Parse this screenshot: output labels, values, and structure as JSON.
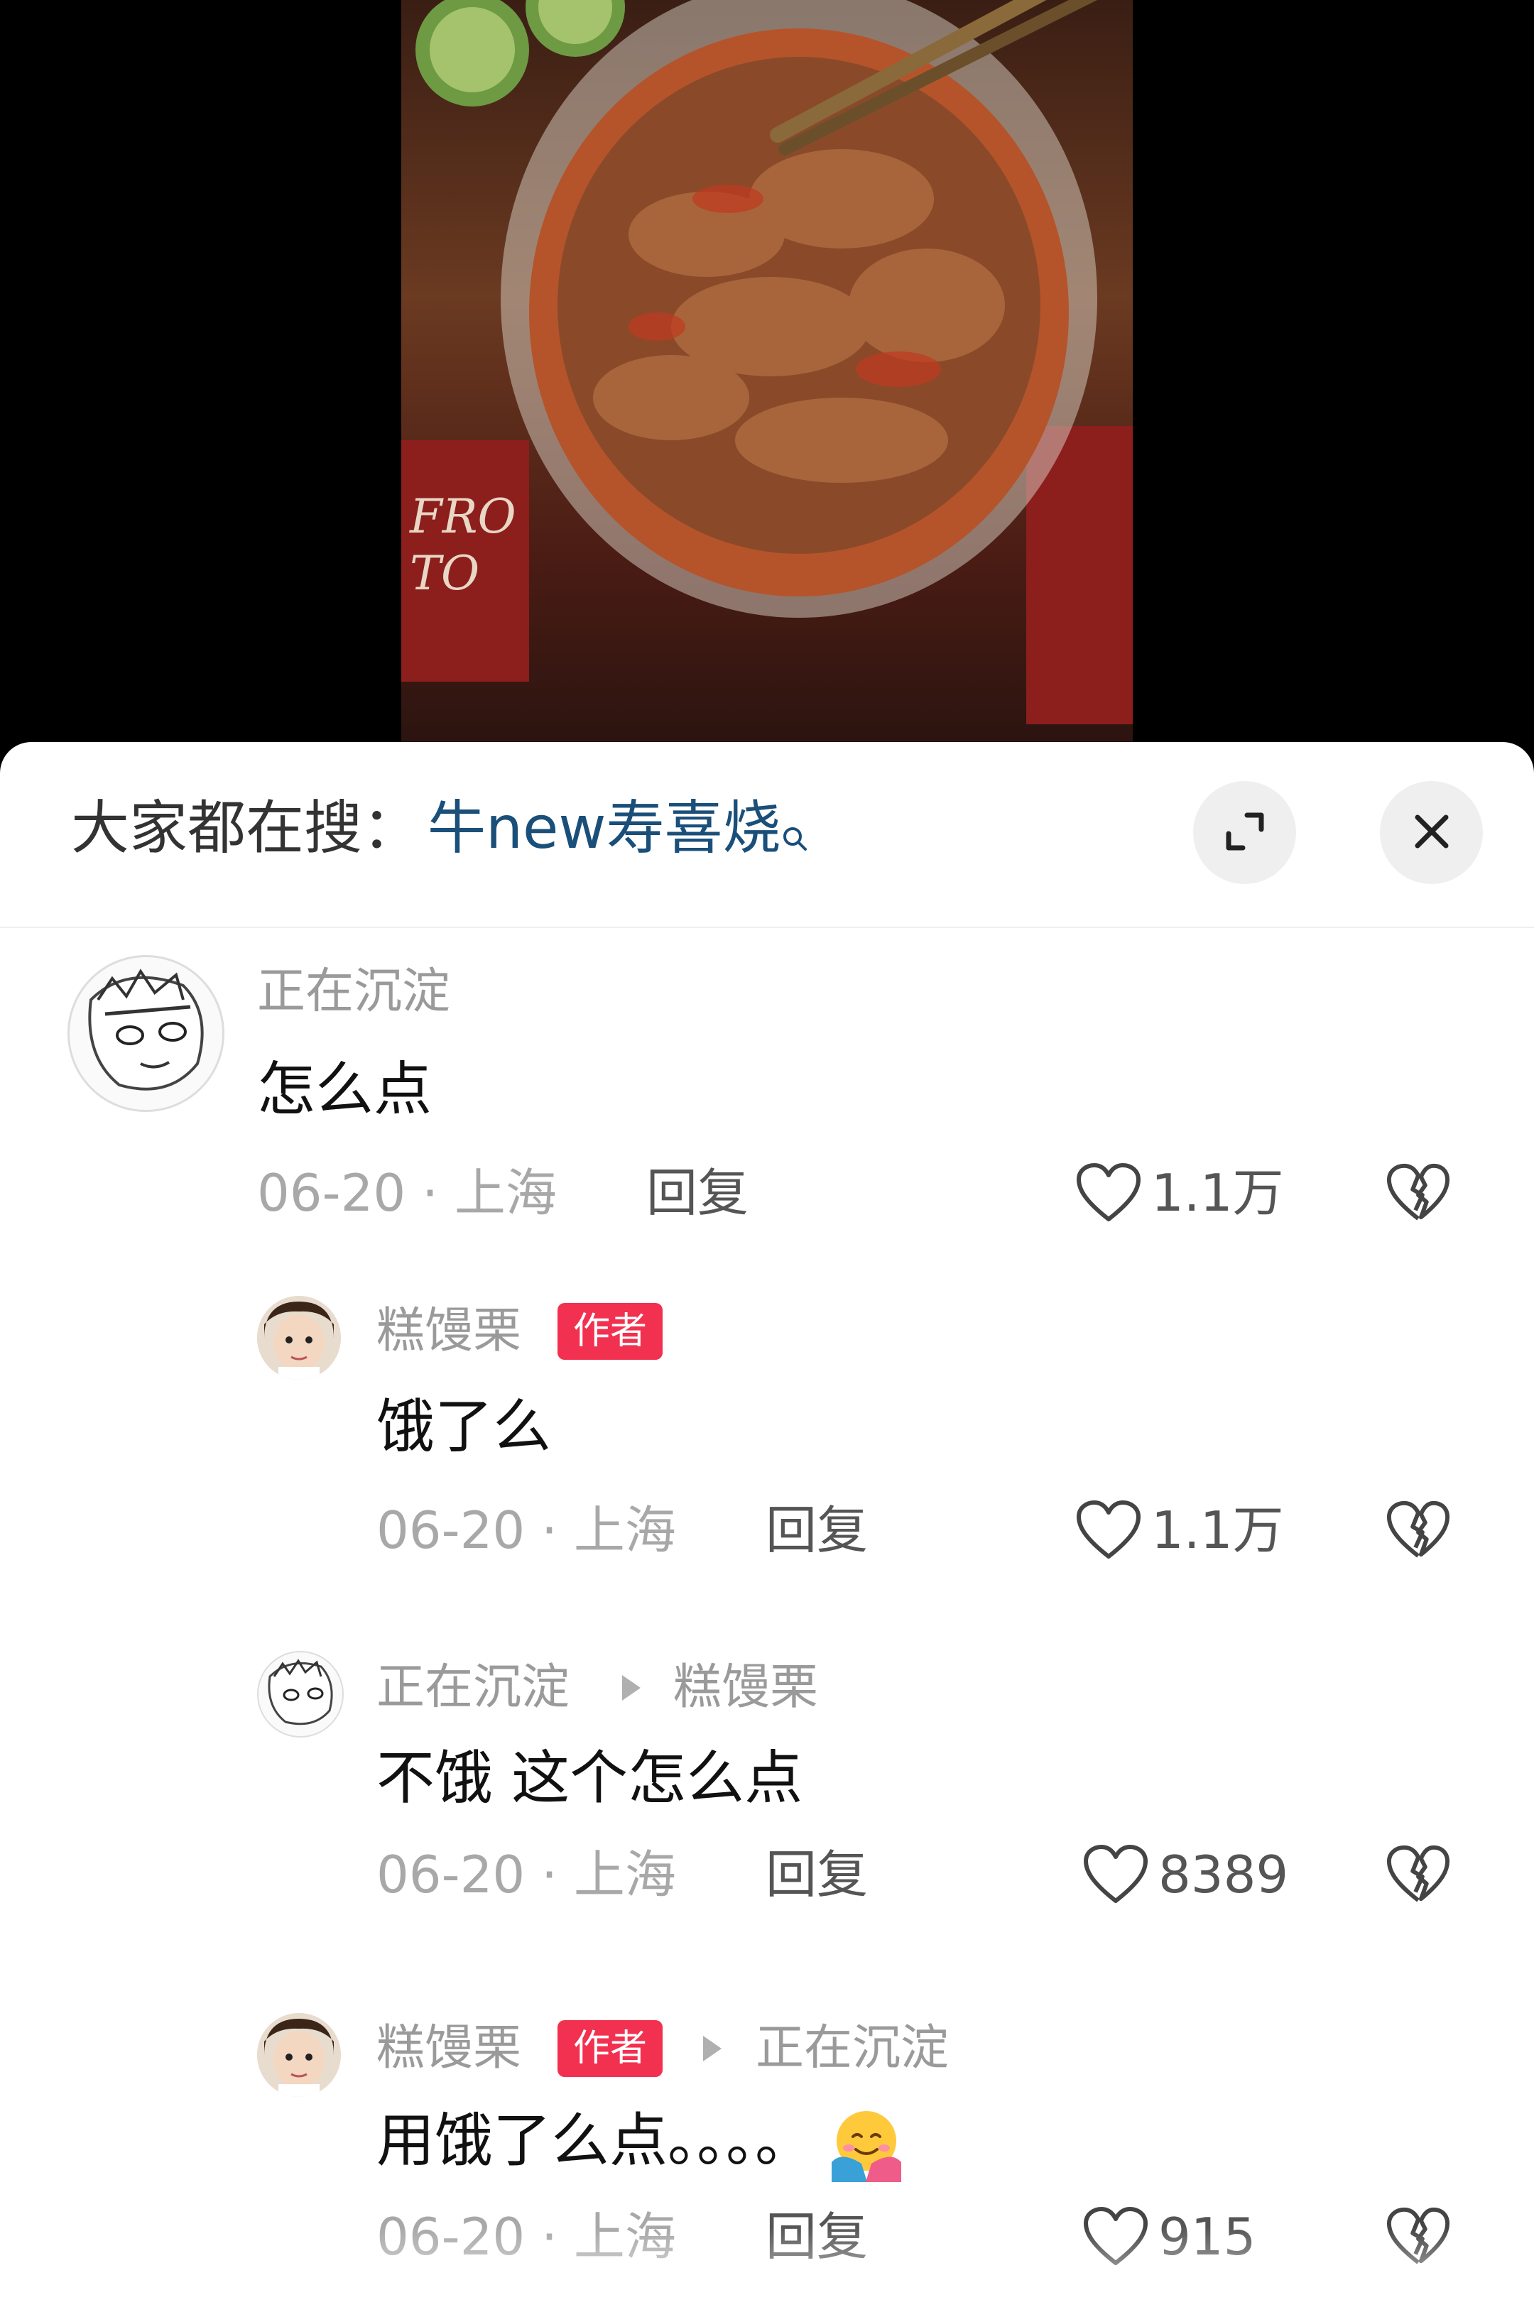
{
  "search_bar": {
    "label": "大家都在搜：",
    "term": "牛new寿喜烧"
  },
  "colors": {
    "search_term": "#1a4f7a",
    "author_tag": "#f2304f",
    "meta_gray": "#a8a8a8"
  },
  "comments": [
    {
      "username": "正在沉淀",
      "text": "怎么点",
      "date": "06-20",
      "location": "上海",
      "reply_label": "回复",
      "likes": "1.1万"
    },
    {
      "username": "糕馒栗",
      "author_tag": "作者",
      "text": "饿了么",
      "date": "06-20",
      "location": "上海",
      "reply_label": "回复",
      "likes": "1.1万"
    },
    {
      "username": "正在沉淀",
      "reply_to": "糕馒栗",
      "text": "不饿 这个怎么点",
      "date": "06-20",
      "location": "上海",
      "reply_label": "回复",
      "likes": "8389"
    },
    {
      "username": "糕馒栗",
      "author_tag": "作者",
      "reply_to": "正在沉淀",
      "text": "用饿了么点。。。。",
      "emoji": "hugging-face",
      "date": "06-20",
      "location": "上海",
      "reply_label": "回复",
      "likes": "915"
    }
  ],
  "meta_separator": "·",
  "icons": {
    "expand": "expand-icon",
    "close": "close-icon",
    "like": "heart-icon",
    "dislike": "broken-heart-icon",
    "search": "search-icon"
  }
}
